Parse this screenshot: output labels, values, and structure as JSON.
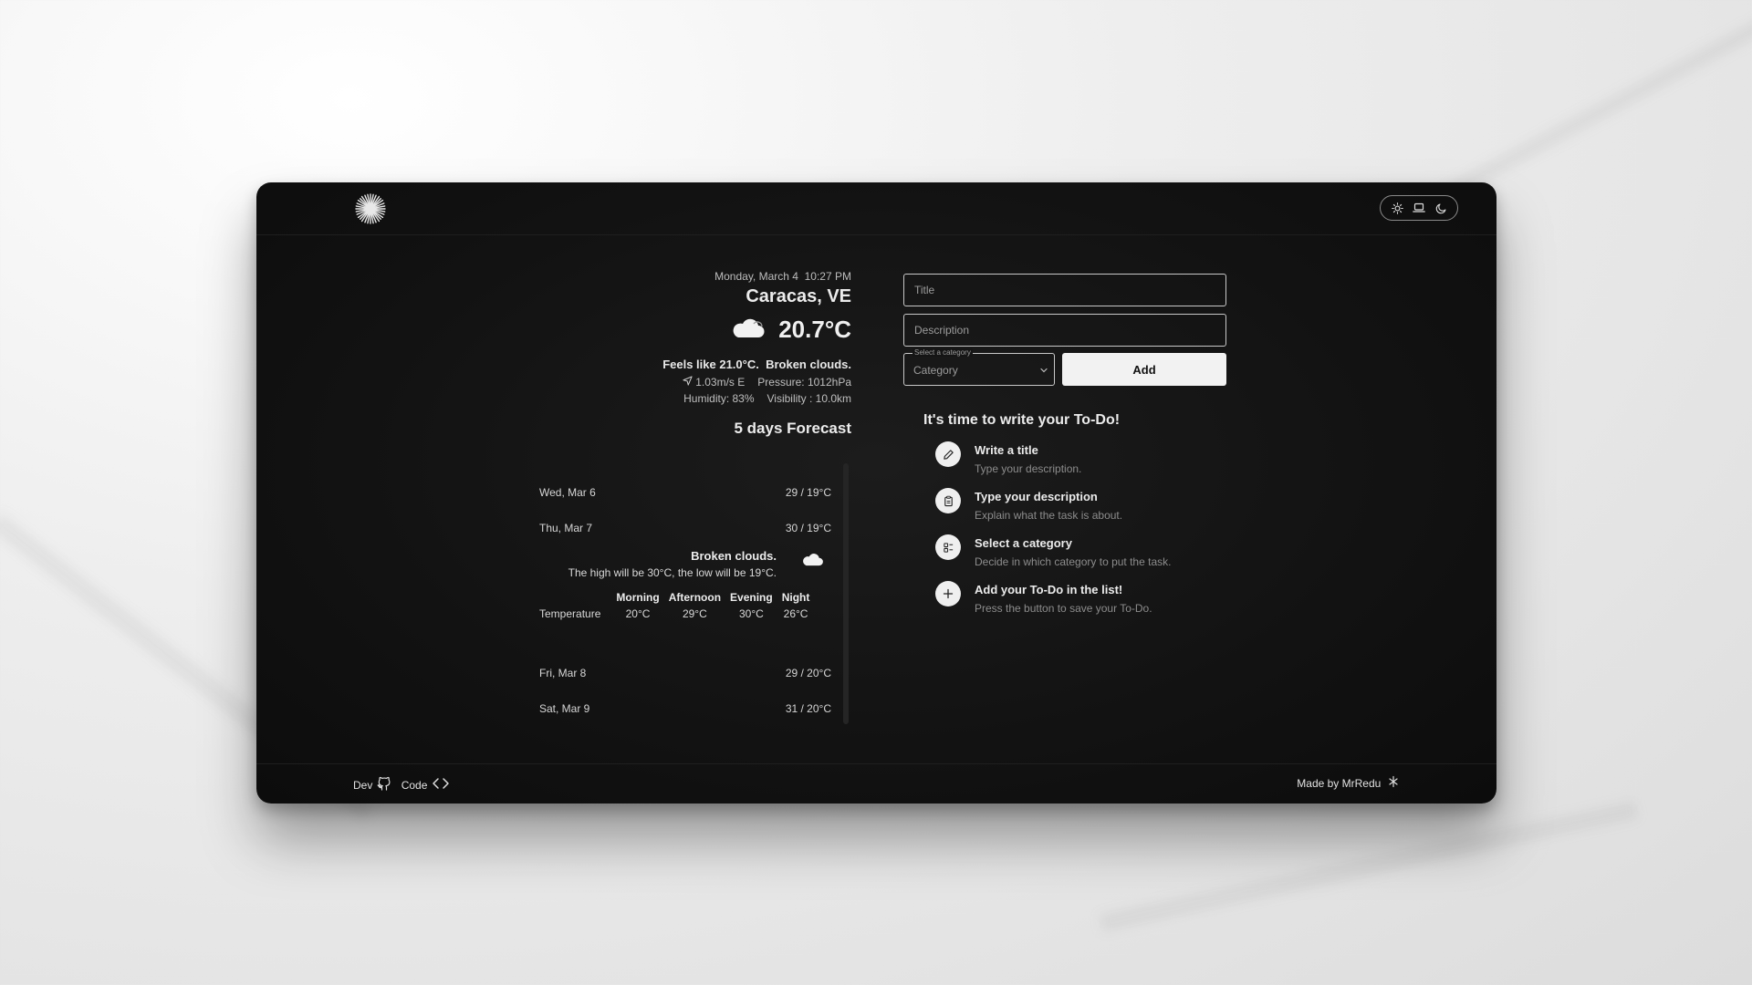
{
  "header": {
    "logo_icon": "sunburst-logo",
    "theme_options": [
      "sun-icon",
      "laptop-icon",
      "moon-icon"
    ]
  },
  "weather": {
    "date": "Monday, March 4",
    "time": "10:27 PM",
    "city": "Caracas, VE",
    "temperature": "20.7°C",
    "icon": "cloud-icon",
    "feels_like": "Feels like 21.0°C.",
    "condition": "Broken clouds.",
    "wind": "1.03m/s E",
    "pressure": "Pressure: 1012hPa",
    "humidity": "Humidity: 83%",
    "visibility": "Visibility : 10.0km",
    "forecast_title": "5 days Forecast"
  },
  "forecast": {
    "days": [
      {
        "day": "Wed, Mar 6",
        "range": "29 / 19°C"
      },
      {
        "day": "Thu, Mar 7",
        "range": "30 / 19°C"
      },
      {
        "day": "Fri, Mar 8",
        "range": "29 / 20°C"
      },
      {
        "day": "Sat, Mar 9",
        "range": "31 / 20°C"
      }
    ],
    "expanded": {
      "title": "Broken clouds.",
      "subtitle": "The high will be 30°C, the low will be 19°C.",
      "row_label": "Temperature",
      "periods": [
        "Morning",
        "Afternoon",
        "Evening",
        "Night"
      ],
      "values": [
        "20°C",
        "29°C",
        "30°C",
        "26°C"
      ]
    }
  },
  "todo": {
    "title_placeholder": "Title",
    "description_placeholder": "Description",
    "category_legend": "Select a category",
    "category_value": "Category",
    "add_label": "Add",
    "steps_title": "It's time to write your To-Do!",
    "steps": [
      {
        "name": "Write a title",
        "desc": "Type your description.",
        "icon": "pencil-icon"
      },
      {
        "name": "Type your description",
        "desc": "Explain what the task is about.",
        "icon": "clipboard-icon"
      },
      {
        "name": "Select a category",
        "desc": "Decide in which category to put the task.",
        "icon": "list-icon"
      },
      {
        "name": "Add your To-Do in the list!",
        "desc": "Press the button to save your To-Do.",
        "icon": "plus-icon"
      }
    ]
  },
  "footer": {
    "dev_label": "Dev",
    "code_label": "Code",
    "made_by": "Made by MrRedu"
  }
}
